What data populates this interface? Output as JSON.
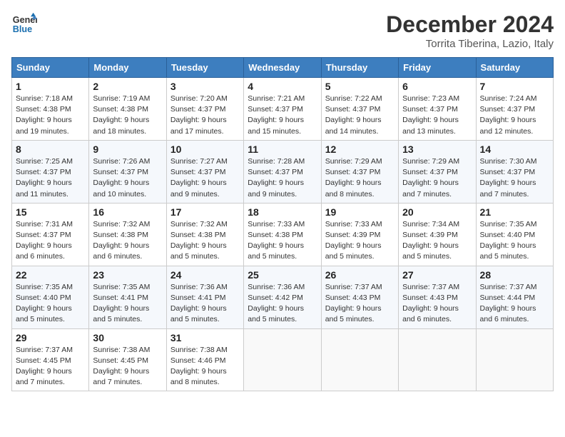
{
  "header": {
    "logo_line1": "General",
    "logo_line2": "Blue",
    "month_title": "December 2024",
    "location": "Torrita Tiberina, Lazio, Italy"
  },
  "weekdays": [
    "Sunday",
    "Monday",
    "Tuesday",
    "Wednesday",
    "Thursday",
    "Friday",
    "Saturday"
  ],
  "weeks": [
    [
      {
        "day": "1",
        "info": "Sunrise: 7:18 AM\nSunset: 4:38 PM\nDaylight: 9 hours\nand 19 minutes."
      },
      {
        "day": "2",
        "info": "Sunrise: 7:19 AM\nSunset: 4:38 PM\nDaylight: 9 hours\nand 18 minutes."
      },
      {
        "day": "3",
        "info": "Sunrise: 7:20 AM\nSunset: 4:37 PM\nDaylight: 9 hours\nand 17 minutes."
      },
      {
        "day": "4",
        "info": "Sunrise: 7:21 AM\nSunset: 4:37 PM\nDaylight: 9 hours\nand 15 minutes."
      },
      {
        "day": "5",
        "info": "Sunrise: 7:22 AM\nSunset: 4:37 PM\nDaylight: 9 hours\nand 14 minutes."
      },
      {
        "day": "6",
        "info": "Sunrise: 7:23 AM\nSunset: 4:37 PM\nDaylight: 9 hours\nand 13 minutes."
      },
      {
        "day": "7",
        "info": "Sunrise: 7:24 AM\nSunset: 4:37 PM\nDaylight: 9 hours\nand 12 minutes."
      }
    ],
    [
      {
        "day": "8",
        "info": "Sunrise: 7:25 AM\nSunset: 4:37 PM\nDaylight: 9 hours\nand 11 minutes."
      },
      {
        "day": "9",
        "info": "Sunrise: 7:26 AM\nSunset: 4:37 PM\nDaylight: 9 hours\nand 10 minutes."
      },
      {
        "day": "10",
        "info": "Sunrise: 7:27 AM\nSunset: 4:37 PM\nDaylight: 9 hours\nand 9 minutes."
      },
      {
        "day": "11",
        "info": "Sunrise: 7:28 AM\nSunset: 4:37 PM\nDaylight: 9 hours\nand 9 minutes."
      },
      {
        "day": "12",
        "info": "Sunrise: 7:29 AM\nSunset: 4:37 PM\nDaylight: 9 hours\nand 8 minutes."
      },
      {
        "day": "13",
        "info": "Sunrise: 7:29 AM\nSunset: 4:37 PM\nDaylight: 9 hours\nand 7 minutes."
      },
      {
        "day": "14",
        "info": "Sunrise: 7:30 AM\nSunset: 4:37 PM\nDaylight: 9 hours\nand 7 minutes."
      }
    ],
    [
      {
        "day": "15",
        "info": "Sunrise: 7:31 AM\nSunset: 4:37 PM\nDaylight: 9 hours\nand 6 minutes."
      },
      {
        "day": "16",
        "info": "Sunrise: 7:32 AM\nSunset: 4:38 PM\nDaylight: 9 hours\nand 6 minutes."
      },
      {
        "day": "17",
        "info": "Sunrise: 7:32 AM\nSunset: 4:38 PM\nDaylight: 9 hours\nand 5 minutes."
      },
      {
        "day": "18",
        "info": "Sunrise: 7:33 AM\nSunset: 4:38 PM\nDaylight: 9 hours\nand 5 minutes."
      },
      {
        "day": "19",
        "info": "Sunrise: 7:33 AM\nSunset: 4:39 PM\nDaylight: 9 hours\nand 5 minutes."
      },
      {
        "day": "20",
        "info": "Sunrise: 7:34 AM\nSunset: 4:39 PM\nDaylight: 9 hours\nand 5 minutes."
      },
      {
        "day": "21",
        "info": "Sunrise: 7:35 AM\nSunset: 4:40 PM\nDaylight: 9 hours\nand 5 minutes."
      }
    ],
    [
      {
        "day": "22",
        "info": "Sunrise: 7:35 AM\nSunset: 4:40 PM\nDaylight: 9 hours\nand 5 minutes."
      },
      {
        "day": "23",
        "info": "Sunrise: 7:35 AM\nSunset: 4:41 PM\nDaylight: 9 hours\nand 5 minutes."
      },
      {
        "day": "24",
        "info": "Sunrise: 7:36 AM\nSunset: 4:41 PM\nDaylight: 9 hours\nand 5 minutes."
      },
      {
        "day": "25",
        "info": "Sunrise: 7:36 AM\nSunset: 4:42 PM\nDaylight: 9 hours\nand 5 minutes."
      },
      {
        "day": "26",
        "info": "Sunrise: 7:37 AM\nSunset: 4:43 PM\nDaylight: 9 hours\nand 5 minutes."
      },
      {
        "day": "27",
        "info": "Sunrise: 7:37 AM\nSunset: 4:43 PM\nDaylight: 9 hours\nand 6 minutes."
      },
      {
        "day": "28",
        "info": "Sunrise: 7:37 AM\nSunset: 4:44 PM\nDaylight: 9 hours\nand 6 minutes."
      }
    ],
    [
      {
        "day": "29",
        "info": "Sunrise: 7:37 AM\nSunset: 4:45 PM\nDaylight: 9 hours\nand 7 minutes."
      },
      {
        "day": "30",
        "info": "Sunrise: 7:38 AM\nSunset: 4:45 PM\nDaylight: 9 hours\nand 7 minutes."
      },
      {
        "day": "31",
        "info": "Sunrise: 7:38 AM\nSunset: 4:46 PM\nDaylight: 9 hours\nand 8 minutes."
      },
      null,
      null,
      null,
      null
    ]
  ]
}
